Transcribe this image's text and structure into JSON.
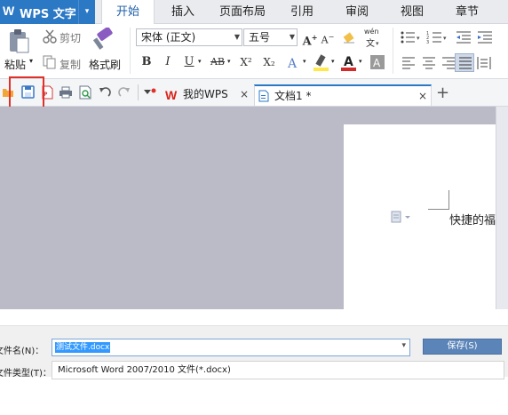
{
  "app": {
    "logo": "W",
    "title": "WPS 文字",
    "dropdown_glyph": "▾"
  },
  "menu_tabs": [
    "开始",
    "插入",
    "页面布局",
    "引用",
    "审阅",
    "视图",
    "章节"
  ],
  "active_menu_tab": "开始",
  "ribbon": {
    "paste_label": "粘贴",
    "cut_label": "剪切",
    "copy_label": "复制",
    "format_painter_label": "格式刷",
    "font_name": "宋体 (正文)",
    "font_size": "五号",
    "bold_label": "B",
    "italic_label": "I",
    "underline_label": "U",
    "strike_label": "AB",
    "superscript_label": "X²",
    "subscript_label": "X₂",
    "font_color_label": "A",
    "wen_label": "wén"
  },
  "quick_access": {
    "tabs": [
      {
        "label": "我的WPS",
        "close": "×"
      },
      {
        "label": "文档1 *",
        "close": "×"
      }
    ],
    "new_tab_label": "+"
  },
  "document": {
    "visible_text": "快捷的福"
  },
  "save_dialog": {
    "filename_label": "文件名(N)：",
    "filename_value": "测试文件.docx",
    "save_button_label": "保存(S)",
    "filetype_label": "文件类型(T)：",
    "filetype_value": "Microsoft Word 2007/2010 文件(*.docx)"
  },
  "colors": {
    "brand_blue": "#2b78c5",
    "highlight_red": "#e0302a",
    "canvas_gray": "#babbc6",
    "save_button": "#5b84b8"
  }
}
